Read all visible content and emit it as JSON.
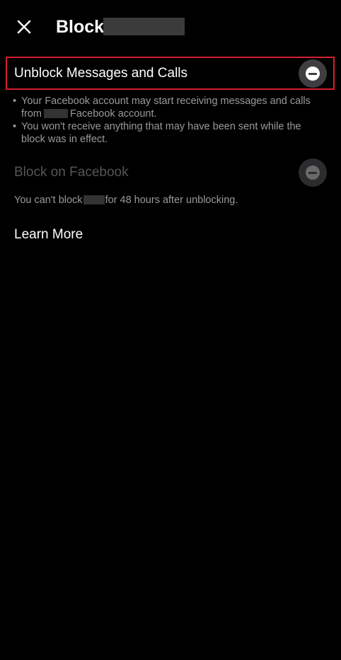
{
  "header": {
    "close_icon": "close-icon",
    "title": "Block"
  },
  "unblock": {
    "label": "Unblock Messages and Calls",
    "icon": "minus-circle-icon",
    "highlight_color": "#d3202f"
  },
  "bullets": {
    "marker": "•",
    "b1_part1": "Your Facebook account may start receiving messages and calls from",
    "b1_part2": "Facebook account.",
    "b2": "You won't receive anything that may have been sent while the block was in effect."
  },
  "facebook_block": {
    "label": "Block on Facebook",
    "icon": "minus-circle-icon"
  },
  "note": {
    "part1": "You can't block",
    "part2": "for 48 hours after unblocking."
  },
  "learn_more": "Learn More"
}
